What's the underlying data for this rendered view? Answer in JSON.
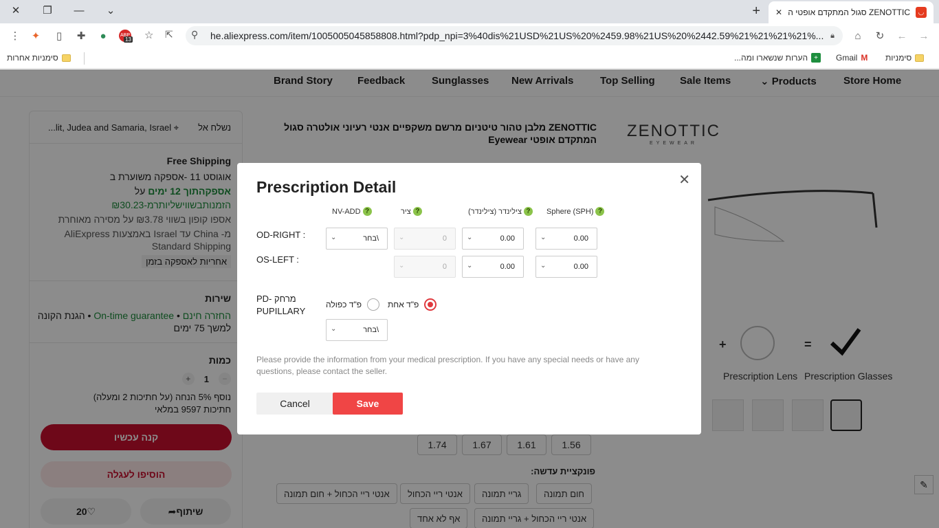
{
  "browser": {
    "tab_title": "ZENOTTIC סגול המתקדם אופטי ה",
    "url": "he.aliexpress.com/item/1005005045858808.html?pdp_npi=3%40dis%21USD%21US%20%2459.98%21US%20%2442.59%21%21%21%21%...",
    "ext_badge": "13",
    "ext_label": "ABP",
    "bookmarks": {
      "bookmarks_label": "סימניות",
      "gmail": "Gmail",
      "notes": "הערות שנשארו ומה...",
      "other": "סימניות אחרות"
    }
  },
  "store_nav": [
    "Store Home",
    "Products",
    "Sale Items",
    "Top Selling",
    "New Arrivals",
    "Sunglasses",
    "Feedback",
    "Brand Story"
  ],
  "left_panel": {
    "ship_to_label": "נשלח אל",
    "ship_to_value": "lit, Judea and Samaria, Israel...",
    "free_shipping": "Free Shipping",
    "delivery_est": "אוגוסט 11 -אספקה משוערת ב",
    "fast_delivery_green": "אספקהתוך 12 ימים",
    "fast_delivery_suffix": "על",
    "fast_delivery_line2": "הזמנותבשווישליותרמ-‏₪30.23",
    "coupon": "אספו קופון בשווי ‏₪3.78 על מסירה מאוחרת",
    "shipping_from": "מ- China עד Israel באמצעות AliExpress",
    "shipping_method": "Standard Shipping",
    "guarantee_badge": "אחריות לאספקה בזמן",
    "service_title": "שירות",
    "service_line1_a": "החזרה חינם",
    "service_line1_b": "On-time guarantee",
    "service_line1_c": "הגנת הקונה",
    "service_line2": "למשך 75 ימים",
    "qty_title": "כמות",
    "qty_value": "1",
    "discount_note": "נוסף 5% הנחה (על חתיכות 2 ומעלה)",
    "stock_note": "חתיכות 9597 במלאי",
    "buy_now": "קנה עכשיו",
    "add_to_cart": "הוסיפו לעגלה",
    "share": "שיתוף",
    "wishlist_count": "20"
  },
  "product": {
    "title": "ZENOTTIC מלבן טהור טיטניום מרשם משקפיים אנטי רעיוני אולטרה סגול המתקדם אופטי Eyewear",
    "brand_name": "ZENOTTIC",
    "brand_sub": "EYEWEAR",
    "combo_lens": "Prescription Lens",
    "combo_glasses": "Prescription Glasses",
    "index_options": [
      "1.56",
      "1.61",
      "1.67",
      "1.74"
    ],
    "function_label": "פונקציית עדשה:",
    "function_options": [
      "חום תמונה",
      "גריי תמונה",
      "אנטי ריי הכחול",
      "אנטי ריי הכחול + חום תמונה",
      "אנטי ריי הכחול + גריי תמונה",
      "אף לא אחד"
    ]
  },
  "modal": {
    "title": "Prescription Detail",
    "columns": {
      "sph": "Sphere (SPH)",
      "cyl": "צילינדר (צילינדר)",
      "axis": "ציר",
      "nv_add": "NV-ADD"
    },
    "help_glyph": "?",
    "rows": {
      "od_label": "OD-RIGHT :",
      "os_label": "OS-LEFT :",
      "od_sph": "0.00",
      "od_cyl": "0.00",
      "od_axis": "0",
      "od_add": "בחר\\",
      "os_sph": "0.00",
      "os_cyl": "0.00",
      "os_axis": "0"
    },
    "pd_label_line1": "PD- מרחק",
    "pd_label_line2": "PUPILLARY",
    "pd_single": "פ\"ד אחת",
    "pd_dual": "פ\"ד כפולה",
    "pd_value": "בחר\\",
    "note": "Please provide the information from your medical prescription. If you have any special needs or have any questions, please contact the seller.",
    "cancel": "Cancel",
    "save": "Save"
  },
  "colors": {
    "accent_red": "#f04545",
    "help_green": "#8bc34a",
    "buy_red": "#c8102e"
  }
}
